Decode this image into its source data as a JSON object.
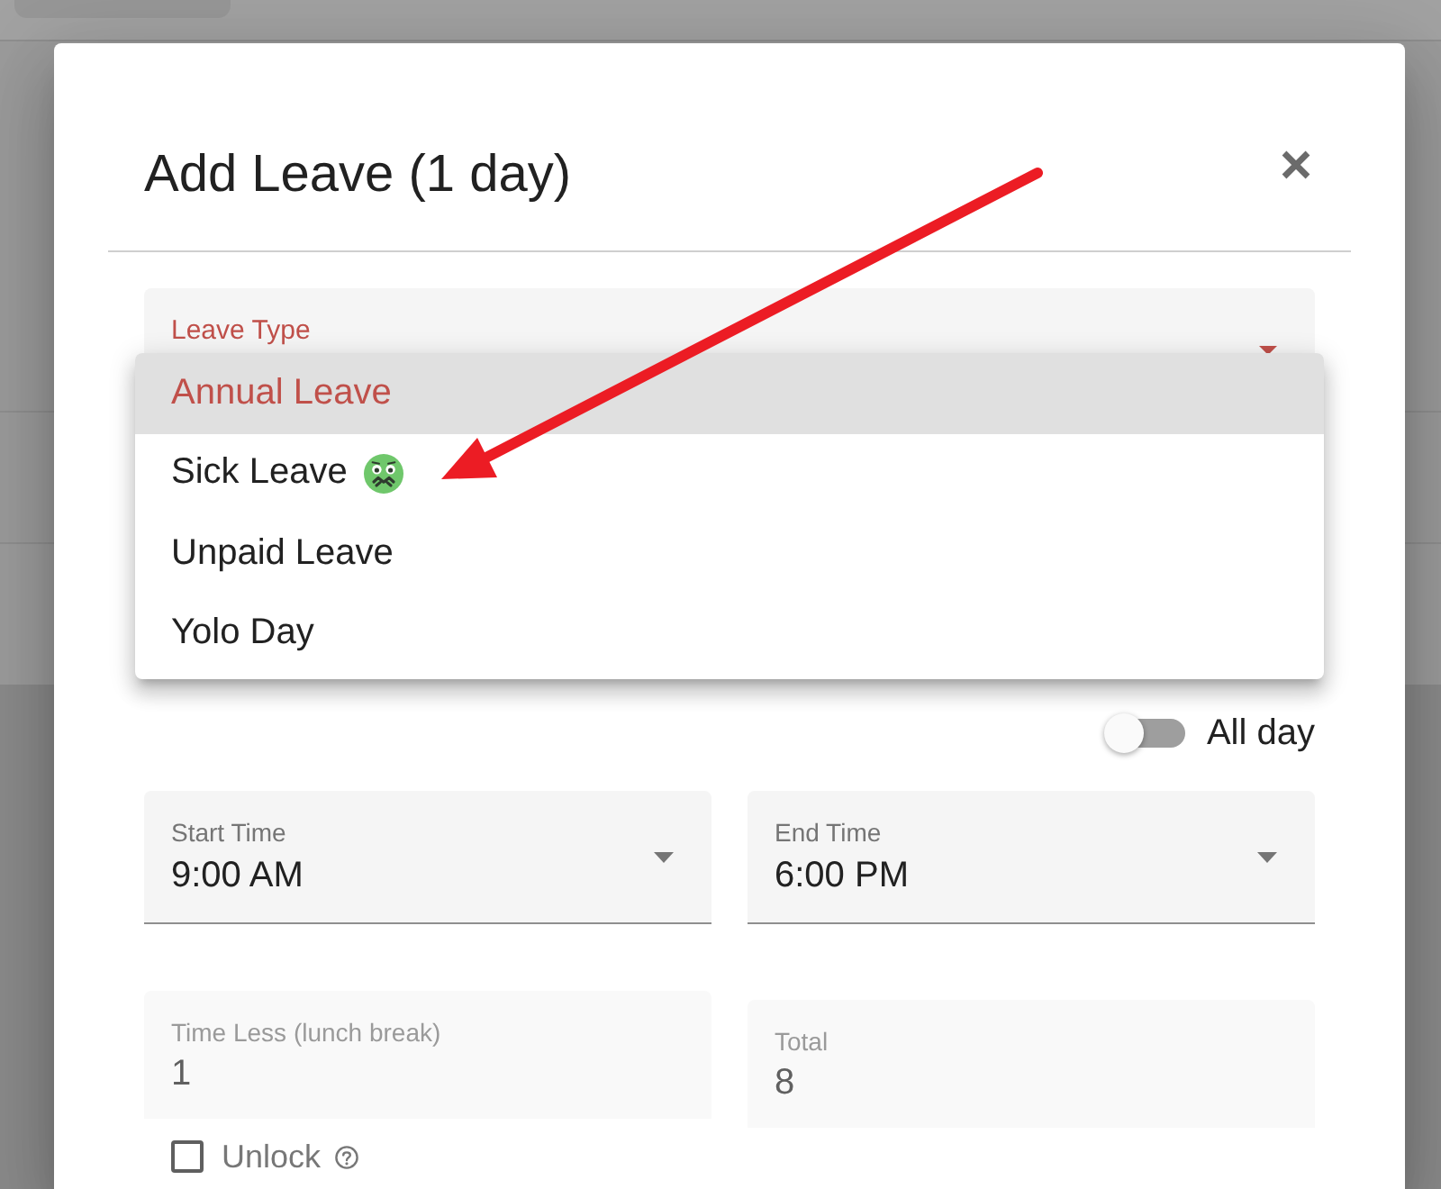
{
  "dialog": {
    "title": "Add Leave (1 day)"
  },
  "leave_type": {
    "label": "Leave Type",
    "expanded": true,
    "options": [
      {
        "label": "Annual Leave",
        "selected": true,
        "kind": "plain"
      },
      {
        "label": "Sick Leave",
        "selected": false,
        "kind": "with-icon"
      },
      {
        "label": "Unpaid Leave",
        "selected": false,
        "kind": "plain"
      },
      {
        "label": "Yolo Day",
        "selected": false,
        "kind": "plain"
      }
    ]
  },
  "all_day": {
    "label": "All day",
    "on": false
  },
  "fields": [
    {
      "label": "Start Time",
      "value": "9:00 AM",
      "kind": "select"
    },
    {
      "label": "End Time",
      "value": "6:00 PM",
      "kind": "select"
    },
    {
      "label": "Time Less (lunch break)",
      "value": "1",
      "kind": "readonly"
    },
    {
      "label": "Total",
      "value": "8",
      "kind": "readonly"
    }
  ],
  "unlock": {
    "label": "Unlock",
    "checked": false
  }
}
